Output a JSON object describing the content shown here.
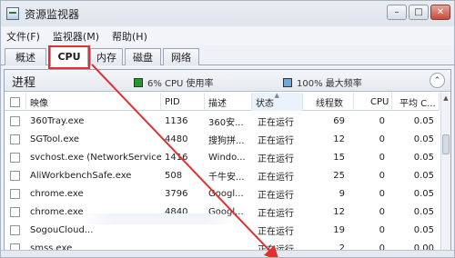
{
  "window": {
    "title": "资源监视器",
    "minimize": "–",
    "maximize": "□",
    "close": "✕"
  },
  "menu": [
    {
      "label": "文件(F)"
    },
    {
      "label": "监视器(M)"
    },
    {
      "label": "帮助(H)"
    }
  ],
  "tabs": [
    {
      "label": "概述"
    },
    {
      "label": "CPU"
    },
    {
      "label": "内存"
    },
    {
      "label": "磁盘"
    },
    {
      "label": "网络"
    }
  ],
  "panel": {
    "title": "进程",
    "cpu_usage": "6% CPU 使用率",
    "max_freq": "100% 最大频率",
    "collapse": "⌃"
  },
  "colors": {
    "cpu_swatch": "#1f9b2a",
    "freq_swatch": "#6ea6d8",
    "highlight": "#e03030"
  },
  "table": {
    "headers": {
      "image": "映像",
      "pid": "PID",
      "desc": "描述",
      "status": "状态",
      "threads": "线程数",
      "cpu": "CPU",
      "avg": "平均 C..."
    },
    "rows": [
      {
        "image": "360Tray.exe",
        "pid": "1136",
        "desc": "360安...",
        "status": "正在运行",
        "threads": "69",
        "cpu": "0",
        "avg": "0.05"
      },
      {
        "image": "SGTool.exe",
        "pid": "4480",
        "desc": "搜狗拼...",
        "status": "正在运行",
        "threads": "12",
        "cpu": "0",
        "avg": "0.05"
      },
      {
        "image": "svchost.exe (NetworkService)",
        "pid": "1416",
        "desc": "Windo...",
        "status": "正在运行",
        "threads": "15",
        "cpu": "0",
        "avg": "0.05"
      },
      {
        "image": "AliWorkbenchSafe.exe",
        "pid": "508",
        "desc": "千牛安...",
        "status": "正在运行",
        "threads": "25",
        "cpu": "0",
        "avg": "0.05"
      },
      {
        "image": "chrome.exe",
        "pid": "3796",
        "desc": "Googl...",
        "status": "正在运行",
        "threads": "9",
        "cpu": "0",
        "avg": "0.05"
      },
      {
        "image": "chrome.exe",
        "pid": "4840",
        "desc": "Googl...",
        "status": "正在运行",
        "threads": "12",
        "cpu": "0",
        "avg": "0.05"
      },
      {
        "image": "SogouCloud...",
        "pid": "",
        "desc": "",
        "status": "正在运行",
        "threads": "19",
        "cpu": "0",
        "avg": "0.05"
      },
      {
        "image": "smss.exe",
        "pid": "",
        "desc": "",
        "status": "正在运行",
        "threads": "2",
        "cpu": "0",
        "avg": "0.00"
      }
    ]
  },
  "scrollbar": {
    "up": "▲",
    "down": "▼"
  }
}
